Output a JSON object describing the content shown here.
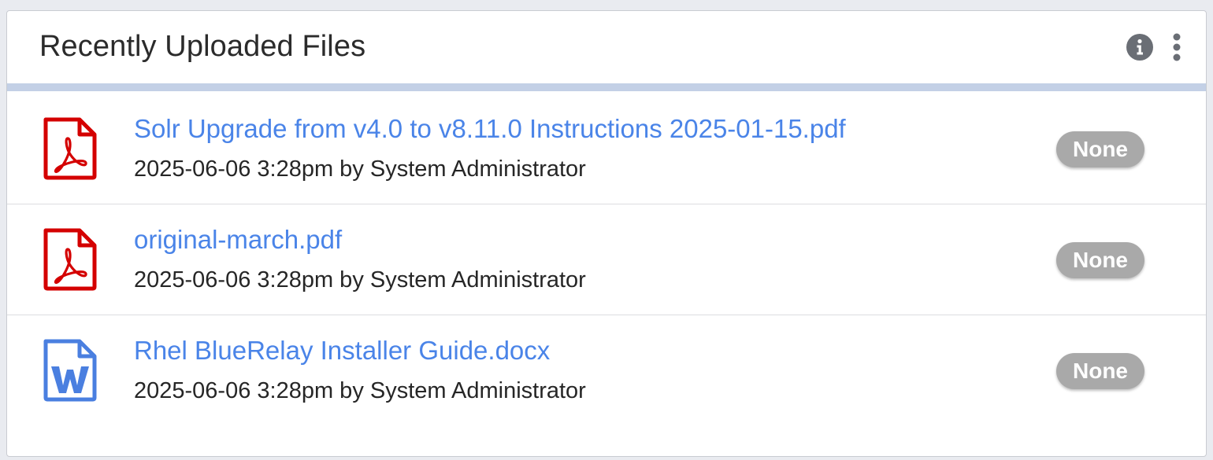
{
  "panel": {
    "title": "Recently Uploaded Files",
    "tools": {
      "info_icon": "info-circle-icon",
      "menu_icon": "kebab-menu-icon"
    }
  },
  "files": [
    {
      "name": "Solr Upgrade from v4.0 to v8.11.0 Instructions 2025-01-15.pdf",
      "meta": "2025-06-06 3:28pm by System Administrator",
      "status": "None",
      "icon": "pdf-file-icon"
    },
    {
      "name": "original-march.pdf",
      "meta": "2025-06-06 3:28pm by System Administrator",
      "status": "None",
      "icon": "pdf-file-icon"
    },
    {
      "name": "Rhel BlueRelay Installer Guide.docx",
      "meta": "2025-06-06 3:28pm by System Administrator",
      "status": "None",
      "icon": "word-file-icon"
    }
  ],
  "colors": {
    "link": "#4a84e8",
    "pdf_red": "#d40000",
    "word_blue": "#4a7fe0",
    "header_rule": "#c3d0e6",
    "pill": "#a9a9a9"
  }
}
